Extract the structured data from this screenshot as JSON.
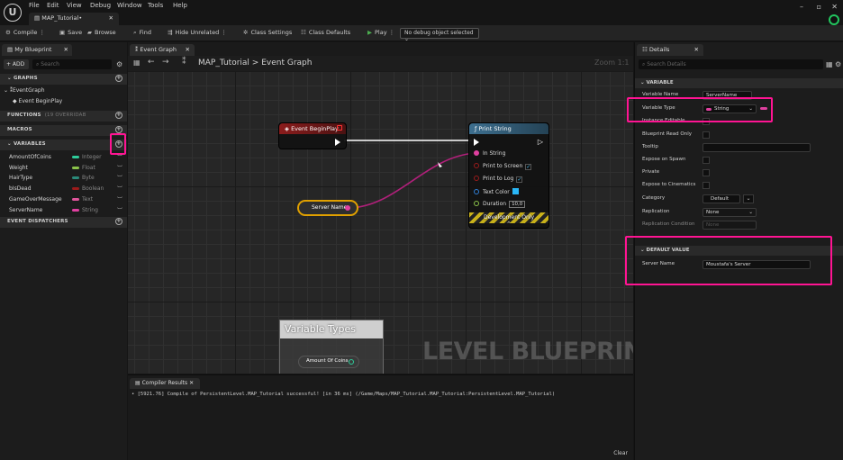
{
  "app": {
    "logo": "U",
    "menu": [
      "File",
      "Edit",
      "View",
      "Debug",
      "Window",
      "Tools",
      "Help"
    ],
    "doc_tab": "MAP_Tutorial•",
    "window_controls": [
      "–",
      "▫",
      "✕"
    ]
  },
  "toolbar": {
    "compile": "Compile",
    "save": "Save",
    "browse": "Browse",
    "find": "Find",
    "hide_unrelated": "Hide Unrelated",
    "class_settings": "Class Settings",
    "class_defaults": "Class Defaults",
    "play": "Play",
    "debug_object": "No debug object selected"
  },
  "my_blueprint": {
    "tab": "My Blueprint",
    "add": "+ ADD",
    "search_placeholder": "Search",
    "graphs_header": "GRAPHS",
    "graph_item": "EventGraph",
    "graph_child": "Event BeginPlay",
    "functions_header": "FUNCTIONS",
    "functions_sub": "(19 OVERRIDAB",
    "macros_header": "MACROS",
    "variables_header": "VARIABLES",
    "dispatchers_header": "EVENT DISPATCHERS",
    "variables": [
      {
        "name": "AmountOfCoins",
        "type": "Integer",
        "color": "#2ecc9a"
      },
      {
        "name": "Weight",
        "type": "Float",
        "color": "#8bc34a"
      },
      {
        "name": "HairType",
        "type": "Byte",
        "color": "#2b8a7a"
      },
      {
        "name": "bIsDead",
        "type": "Boolean",
        "color": "#9b1b1b"
      },
      {
        "name": "GameOverMessage",
        "type": "Text",
        "color": "#e0559c"
      },
      {
        "name": "ServerName",
        "type": "String",
        "color": "#e040a0"
      }
    ]
  },
  "graph": {
    "tab": "Event Graph",
    "breadcrumb": "MAP_Tutorial > Event Graph",
    "zoom": "Zoom 1:1",
    "begin_play_title": "Event BeginPlay",
    "print_string_title": "Print String",
    "pins": {
      "in_string": "In String",
      "print_to_screen": "Print to Screen",
      "print_to_log": "Print to Log",
      "text_color": "Text Color",
      "duration": "Duration",
      "duration_value": "10,0"
    },
    "dev_only": "Development Only",
    "server_name_node": "Server Name",
    "comment_title": "Variable Types",
    "amount_node": "Amount Of Coins",
    "watermark": "LEVEL BLUEPRINT"
  },
  "compiler": {
    "tab": "Compiler Results",
    "log": "• [5921.76] Compile of PersistentLevel.MAP_Tutorial successful! [in 36 ms] (/Game/Maps/MAP_Tutorial.MAP_Tutorial:PersistentLevel.MAP_Tutorial)",
    "clear": "Clear"
  },
  "details": {
    "tab": "Details",
    "search_placeholder": "Search Details",
    "variable_header": "VARIABLE",
    "rows": {
      "variable_name_label": "Variable Name",
      "variable_name_value": "ServerName",
      "variable_type_label": "Variable Type",
      "variable_type_value": "String",
      "instance_editable": "Instance Editable",
      "blueprint_read_only": "Blueprint Read Only",
      "tooltip": "Tooltip",
      "expose_on_spawn": "Expose on Spawn",
      "private": "Private",
      "expose_to_cinematics": "Expose to Cinematics",
      "category_label": "Category",
      "category_value": "Default",
      "replication_label": "Replication",
      "replication_value": "None",
      "replication_condition_label": "Replication Condition",
      "replication_condition_value": "None"
    },
    "default_value_header": "DEFAULT VALUE",
    "server_name_label": "Server Name",
    "server_name_value": "Moustafa's Server"
  },
  "colors": {
    "highlight": "#ff1493",
    "string_pin": "#e040a0",
    "event_header": "#8b1c1c",
    "function_header": "#3d6f8f",
    "play_green": "#4caf50"
  }
}
